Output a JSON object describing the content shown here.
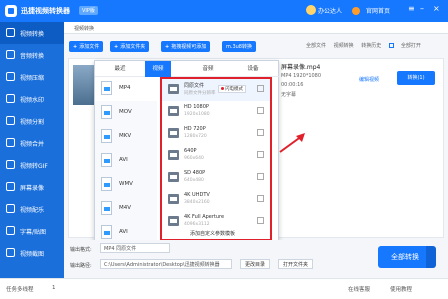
{
  "app": {
    "title": "迅捷视频转换器",
    "version": "VIP版"
  },
  "titlebar": {
    "user": "办公达人",
    "home": "官网首页"
  },
  "sidebar": {
    "items": [
      {
        "label": "视频转换"
      },
      {
        "label": "音频转换"
      },
      {
        "label": "视频压缩"
      },
      {
        "label": "视频水印"
      },
      {
        "label": "视频分割"
      },
      {
        "label": "视频合并"
      },
      {
        "label": "视频转GIF"
      },
      {
        "label": "屏幕录像"
      },
      {
        "label": "视频配乐"
      },
      {
        "label": "字幕/贴图"
      },
      {
        "label": "视频截图"
      }
    ]
  },
  "breadcrumb": "视频转换",
  "toolbar": {
    "add_file": "添加文件",
    "add_folder": "添加文件夹",
    "drag": "拖拽视频可添加",
    "batch": "m.3u8转换",
    "right_tabs": [
      "全部文件",
      "视频转换",
      "转换历史",
      "全部打开"
    ]
  },
  "file": {
    "name": "屏幕录像.mp4",
    "fmt_line": "MP4 1920*1080",
    "duration": "00:00:16",
    "subtitle": "无字幕",
    "edit_link": "编辑视频",
    "convert": "转换(1)"
  },
  "popup": {
    "tabs": [
      "最近",
      "视频",
      "音频",
      "设备"
    ],
    "formats": [
      "MP4",
      "MOV",
      "MKV",
      "AVI",
      "WMV",
      "M4V",
      "AVI"
    ],
    "qualities": [
      {
        "name": "同原文件",
        "size": "同原文件分辨率"
      },
      {
        "name": "HD 1080P",
        "size": "1920x1080"
      },
      {
        "name": "HD 720P",
        "size": "1280x720"
      },
      {
        "name": "640P",
        "size": "960x640"
      },
      {
        "name": "SD 480P",
        "size": "640x480"
      },
      {
        "name": "4K UHDTV",
        "size": "3840x2160"
      },
      {
        "name": "4K Full Aperture",
        "size": "4096x3112"
      }
    ],
    "tag": "闪电模式",
    "customize": "添加自定义参数模板"
  },
  "bottom": {
    "out_format_label": "输出格式:",
    "out_format_value": "MP4 同原文件",
    "out_path_label": "输出路径:",
    "out_path_value": "C:\\Users\\Administrator\\Desktop\\迅捷视频转换器",
    "change_dir": "更改目录",
    "open_folder": "打开文件夹",
    "convert_all": "全部转换"
  },
  "status": {
    "tasks": "任务多线程",
    "tasks_value": "1",
    "service": "在线客服",
    "help": "使用教程"
  }
}
